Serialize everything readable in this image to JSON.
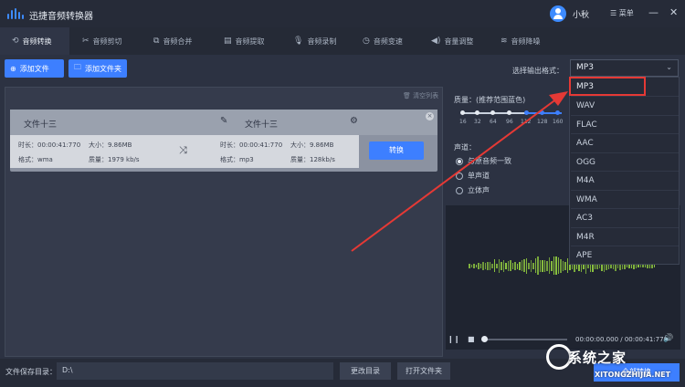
{
  "app": {
    "title": "迅捷音频转换器",
    "username": "小秋",
    "menu_label": "菜单",
    "minimize": "—",
    "close": "✕"
  },
  "nav": {
    "tabs": [
      {
        "label": "音频转换",
        "icon": "convert-icon"
      },
      {
        "label": "音频剪切",
        "icon": "scissors-icon"
      },
      {
        "label": "音频合并",
        "icon": "merge-icon"
      },
      {
        "label": "音频提取",
        "icon": "extract-icon"
      },
      {
        "label": "音频录制",
        "icon": "mic-icon"
      },
      {
        "label": "音频变速",
        "icon": "speed-icon"
      },
      {
        "label": "音量调整",
        "icon": "volume-icon"
      },
      {
        "label": "音频降噪",
        "icon": "noise-icon"
      }
    ]
  },
  "toolbar": {
    "add_file": "添加文件",
    "add_folder": "添加文件夹",
    "format_label": "选择输出格式：",
    "format_value": "MP3"
  },
  "file_list": {
    "clear_label": "清空列表",
    "card": {
      "source_name": "文件十三",
      "target_name": "文件十三",
      "source": {
        "duration_label": "时长：",
        "duration": "00:00:41:770",
        "size_label": "大小：",
        "size": "9.86MB",
        "format_label": "格式：",
        "format": "wma",
        "quality_label": "质量：",
        "quality": "1979 kb/s"
      },
      "target": {
        "duration_label": "时长：",
        "duration": "00:00:41:770",
        "size_label": "大小：",
        "size": "9.86MB",
        "format_label": "格式：",
        "format": "mp3",
        "quality_label": "质量：",
        "quality": "128kb/s"
      },
      "convert_label": "转换"
    }
  },
  "settings": {
    "quality_label": "质量：(推荐范围蓝色)",
    "quality_ticks": [
      "16",
      "32",
      "64",
      "96",
      "112",
      "128",
      "160"
    ],
    "channel_label": "声道：",
    "channels": [
      "与原音频一致",
      "单声道",
      "立体声"
    ]
  },
  "player": {
    "time": "00:00:00.000 / 00:00:41:770",
    "play": "❙❙",
    "stop": "■",
    "volume": "🔊"
  },
  "dropdown": {
    "options": [
      "MP3",
      "WAV",
      "FLAC",
      "AAC",
      "OGG",
      "M4A",
      "WMA",
      "AC3",
      "M4R",
      "APE"
    ]
  },
  "bottom": {
    "save_label": "文件保存目录：",
    "save_path": "D:\\",
    "change_dir": "更改目录",
    "open_folder": "打开文件夹",
    "convert_all": "全部转换"
  },
  "watermark": {
    "text": "系统之家",
    "url": "XITONGZHIJIA.NET"
  },
  "colors": {
    "accent": "#3d7fff",
    "highlight": "#e53935",
    "wave_green": "#8dc63f"
  }
}
